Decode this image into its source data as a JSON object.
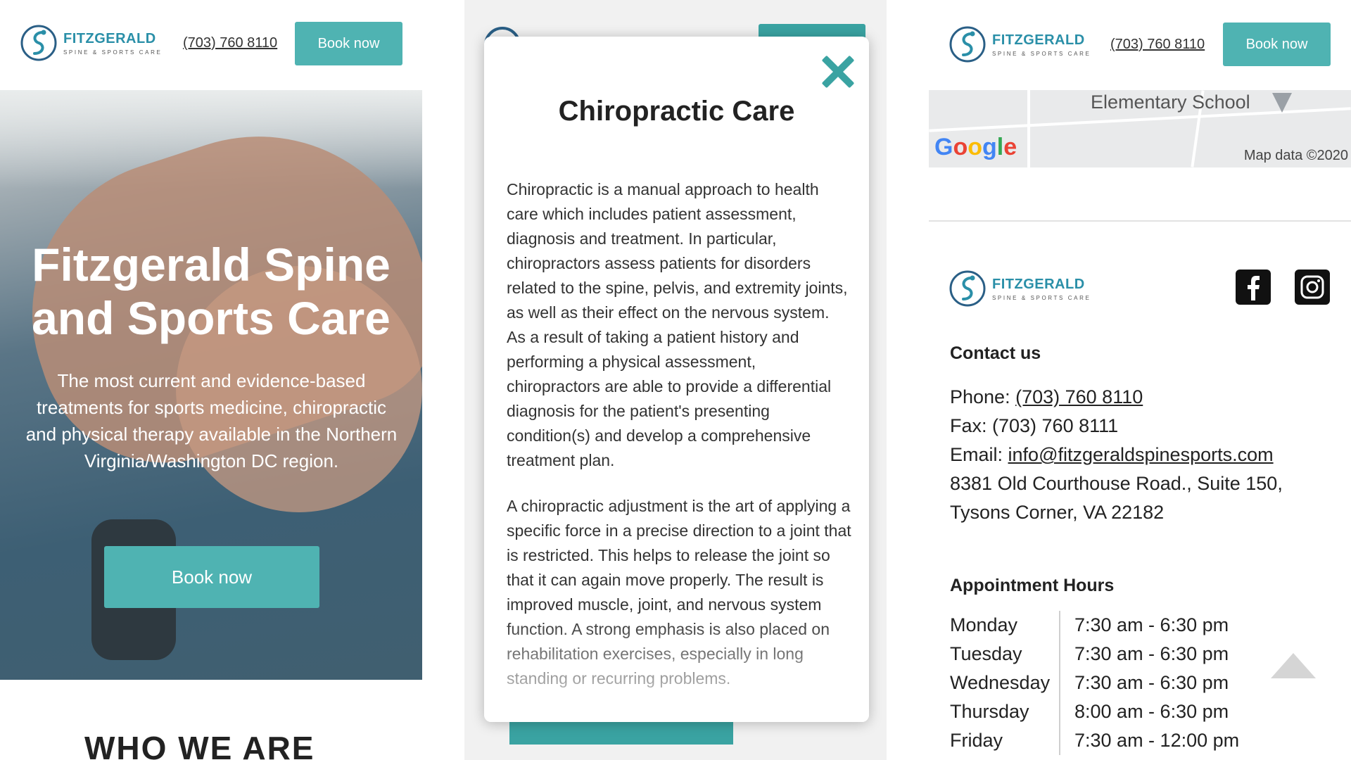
{
  "brand": {
    "name": "FITZGERALD",
    "subtitle": "SPINE & SPORTS CARE",
    "accent_color": "#4fb3b2",
    "logo_color": "#2a8fa8"
  },
  "header": {
    "phone": "(703) 760 8110",
    "book_label": "Book now"
  },
  "hero": {
    "title": "Fitzgerald Spine and Sports Care",
    "text": "The most current and evidence-based treatments for sports medicine, chiropractic and physical therapy available in the Northern Virginia/Washington DC region.",
    "button_label": "Book now"
  },
  "section": {
    "who_we_are": "WHO WE ARE"
  },
  "modal": {
    "close_icon": "close-icon",
    "title": "Chiropractic Care",
    "paragraphs": [
      "Chiropractic is a manual approach to health care which includes patient assessment, diagnosis and treatment. In particular, chiropractors assess patients for disorders related to the spine, pelvis, and extremity joints, as well as their effect on the nervous system. As a result of taking a patient history and performing a physical assessment, chiropractors are able to provide a differential diagnosis for the patient's presenting condition(s) and develop a comprehensive treatment plan.",
      "A chiropractic adjustment is the art of applying a specific force in a precise direction to a joint that is restricted. This helps to release the joint so that it can again move properly. The result is improved muscle, joint, and nervous system function. A strong emphasis is also placed on rehabilitation exercises, especially in long standing or recurring problems."
    ]
  },
  "map": {
    "label": "Elementary School",
    "google": "Google",
    "attribution": "Map data ©2020"
  },
  "footer": {
    "social": [
      "facebook-icon",
      "instagram-icon"
    ],
    "contact_heading": "Contact us",
    "phone_label": "Phone:",
    "phone": "(703) 760 8110",
    "fax": "Fax: (703) 760 8111",
    "email_label": "Email:",
    "email": "info@fitzgeraldspinesports.com",
    "address_line1": "8381 Old Courthouse Road., Suite 150,",
    "address_line2": "Tysons Corner, VA 22182",
    "hours_heading": "Appointment Hours",
    "hours": [
      {
        "day": "Monday",
        "time": "7:30 am - 6:30 pm"
      },
      {
        "day": "Tuesday",
        "time": "7:30 am - 6:30 pm"
      },
      {
        "day": "Wednesday",
        "time": "7:30 am - 6:30 pm"
      },
      {
        "day": "Thursday",
        "time": "8:00 am - 6:30 pm"
      },
      {
        "day": "Friday",
        "time": "7:30 am - 12:00 pm"
      }
    ]
  }
}
